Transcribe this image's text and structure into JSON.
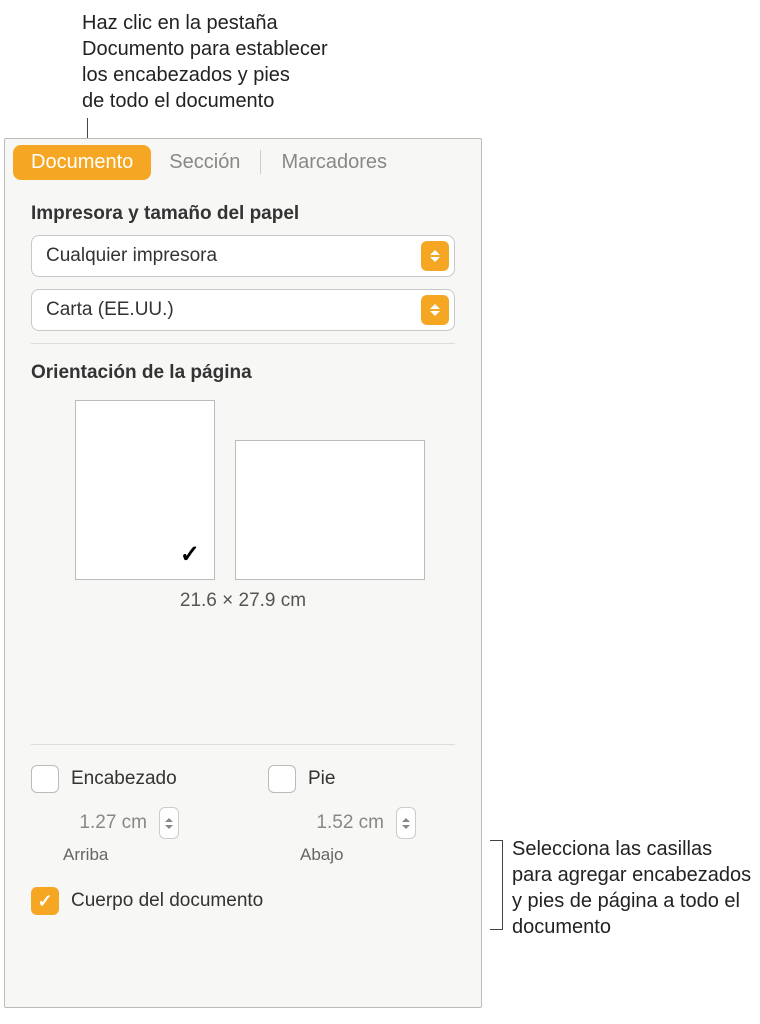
{
  "callouts": {
    "top": "Haz clic en la pestaña Documento para establecer los encabezados y pies de todo el documento",
    "right": "Selecciona las casillas para agregar encabezados y pies de página a todo el documento"
  },
  "tabs": {
    "document": "Documento",
    "section": "Sección",
    "bookmarks": "Marcadores"
  },
  "printer_section": {
    "title": "Impresora y tamaño del papel",
    "printer": "Cualquier impresora",
    "paper": "Carta (EE.UU.)"
  },
  "orientation": {
    "title": "Orientación de la página",
    "check": "✓",
    "dimensions": "21.6 × 27.9 cm"
  },
  "header_footer": {
    "header_label": "Encabezado",
    "footer_label": "Pie",
    "header_value": "1.27 cm",
    "footer_value": "1.52 cm",
    "top_label": "Arriba",
    "bottom_label": "Abajo"
  },
  "body": {
    "label": "Cuerpo del documento"
  }
}
